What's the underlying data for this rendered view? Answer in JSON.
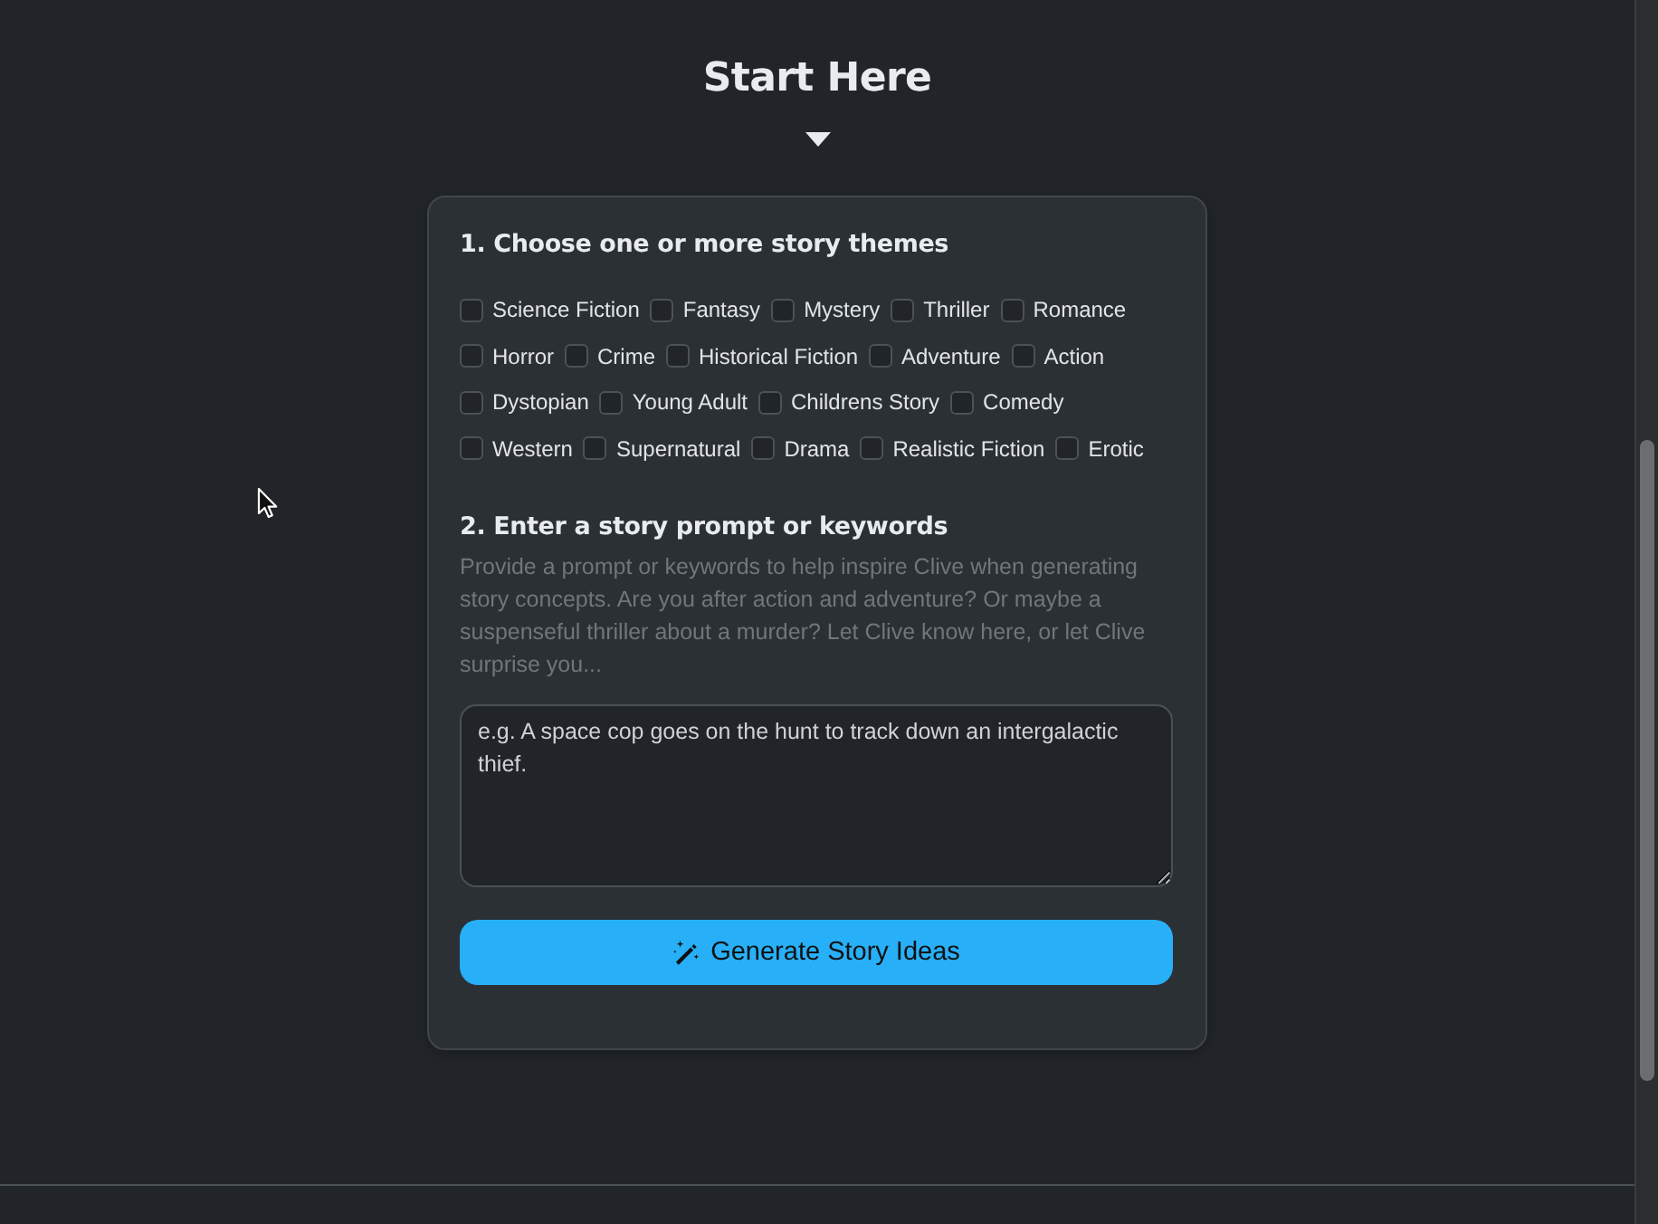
{
  "page": {
    "title": "Start Here"
  },
  "themes_section": {
    "heading": "1. Choose one or more story themes",
    "rows": [
      {
        "options": [
          {
            "label": "Science Fiction",
            "checked": false
          },
          {
            "label": "Fantasy",
            "checked": false
          },
          {
            "label": "Mystery",
            "checked": false
          },
          {
            "label": "Thriller",
            "checked": false
          },
          {
            "label": "Romance",
            "checked": false
          }
        ]
      },
      {
        "options": [
          {
            "label": "Horror",
            "checked": false
          },
          {
            "label": "Crime",
            "checked": false
          },
          {
            "label": "Historical Fiction",
            "checked": false
          },
          {
            "label": "Adventure",
            "checked": false
          },
          {
            "label": "Action",
            "checked": false
          }
        ]
      },
      {
        "options": [
          {
            "label": "Dystopian",
            "checked": false
          },
          {
            "label": "Young Adult",
            "checked": false
          },
          {
            "label": "Childrens Story",
            "checked": false
          },
          {
            "label": "Comedy",
            "checked": false
          }
        ]
      },
      {
        "options": [
          {
            "label": "Western",
            "checked": false
          },
          {
            "label": "Supernatural",
            "checked": false
          },
          {
            "label": "Drama",
            "checked": false
          },
          {
            "label": "Realistic Fiction",
            "checked": false
          },
          {
            "label": "Erotic",
            "checked": false
          }
        ]
      }
    ]
  },
  "prompt_section": {
    "heading": "2. Enter a story prompt or keywords",
    "description": "Provide a prompt or keywords to help inspire Clive when generating story concepts. Are you after action and adventure? Or maybe a suspenseful thriller about a murder? Let Clive know here, or let Clive surprise you...",
    "field": {
      "placeholder": "e.g. A space cop goes on the hunt to track down an intergalactic thief."
    }
  },
  "generate_button": {
    "label": "Generate Story Ideas"
  }
}
